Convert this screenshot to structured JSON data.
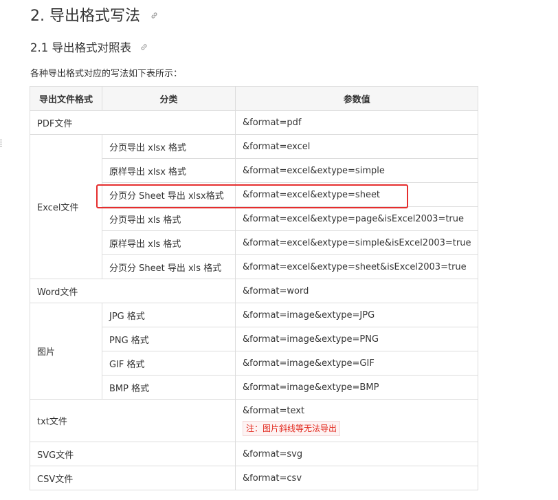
{
  "heading2": "2. 导出格式写法",
  "heading3": "2.1 导出格式对照表",
  "intro": "各种导出格式对应的写法如下表所示：",
  "table": {
    "headers": [
      "导出文件格式",
      "分类",
      "参数值"
    ],
    "rows": {
      "pdf": {
        "format": "PDF文件",
        "value": "&format=pdf"
      },
      "excel": {
        "format": "Excel文件",
        "subs": [
          {
            "category": "分页导出 xlsx 格式",
            "value": "&format=excel"
          },
          {
            "category": "原样导出 xlsx 格式",
            "value": "&format=excel&extype=simple"
          },
          {
            "category": "分页分 Sheet 导出 xlsx格式",
            "value": "&format=excel&extype=sheet"
          },
          {
            "category": "分页导出 xls 格式",
            "value": "&format=excel&extype=page&isExcel2003=true"
          },
          {
            "category": "原样导出 xls 格式",
            "value": "&format=excel&extype=simple&isExcel2003=true"
          },
          {
            "category": "分页分 Sheet 导出 xls 格式",
            "value": "&format=excel&extype=sheet&isExcel2003=true"
          }
        ]
      },
      "word": {
        "format": "Word文件",
        "value": "&format=word"
      },
      "image": {
        "format": "图片",
        "subs": [
          {
            "category": "JPG 格式",
            "value": "&format=image&extype=JPG"
          },
          {
            "category": "PNG 格式",
            "value": "&format=image&extype=PNG"
          },
          {
            "category": "GIF 格式",
            "value": "&format=image&extype=GIF"
          },
          {
            "category": "BMP 格式",
            "value": "&format=image&extype=BMP"
          }
        ]
      },
      "txt": {
        "format": "txt文件",
        "value": "&format=text",
        "note": "注：图片斜线等无法导出"
      },
      "svg": {
        "format": "SVG文件",
        "value": "&format=svg"
      },
      "csv": {
        "format": "CSV文件",
        "value": "&format=csv"
      }
    }
  },
  "colors": {
    "highlight": "#e52d2d",
    "note_text": "#e2261b"
  }
}
